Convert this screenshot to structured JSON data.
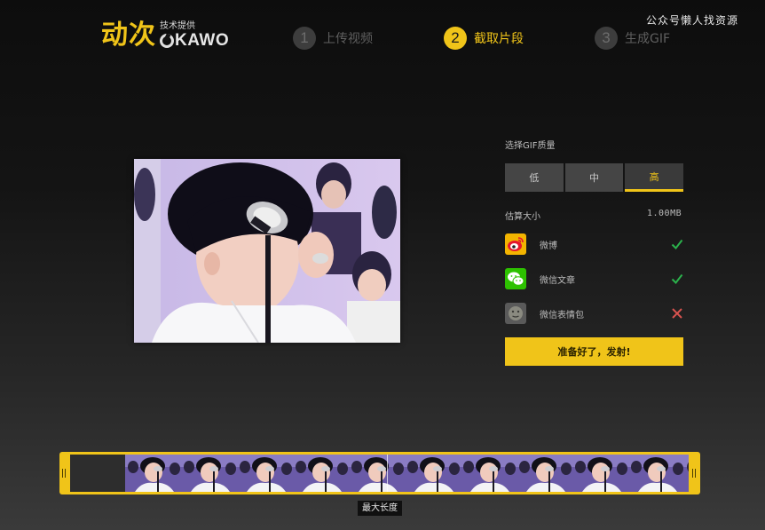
{
  "header": {
    "logo_cn": "动次",
    "tech_label": "技术提供",
    "kawo_text": "KAWO",
    "watermark": "公众号懒人找资源",
    "steps": [
      {
        "num": "1",
        "label": "上传视频",
        "active": false
      },
      {
        "num": "2",
        "label": "截取片段",
        "active": true
      },
      {
        "num": "3",
        "label": "生成GIF",
        "active": false
      }
    ]
  },
  "panel": {
    "quality_label": "选择GIF质量",
    "quality_options": [
      "低",
      "中",
      "高"
    ],
    "quality_selected": "高",
    "size_label": "估算大小",
    "size_value": "1.00MB",
    "platforms": [
      {
        "name": "微博",
        "icon": "weibo-icon",
        "status": "check-icon"
      },
      {
        "name": "微信文章",
        "icon": "wechat-icon",
        "status": "check-icon"
      },
      {
        "name": "微信表情包",
        "icon": "sticker-icon",
        "status": "cross-icon"
      }
    ],
    "go_button": "准备好了，发射!"
  },
  "timeline": {
    "max_length_label": "最大长度",
    "selected_fraction": 0.09
  },
  "colors": {
    "accent": "#f0c419",
    "check": "#2bb24c",
    "cross": "#d9534f",
    "weibo_bg": "#f3b400",
    "wechat_bg": "#2dc100"
  }
}
